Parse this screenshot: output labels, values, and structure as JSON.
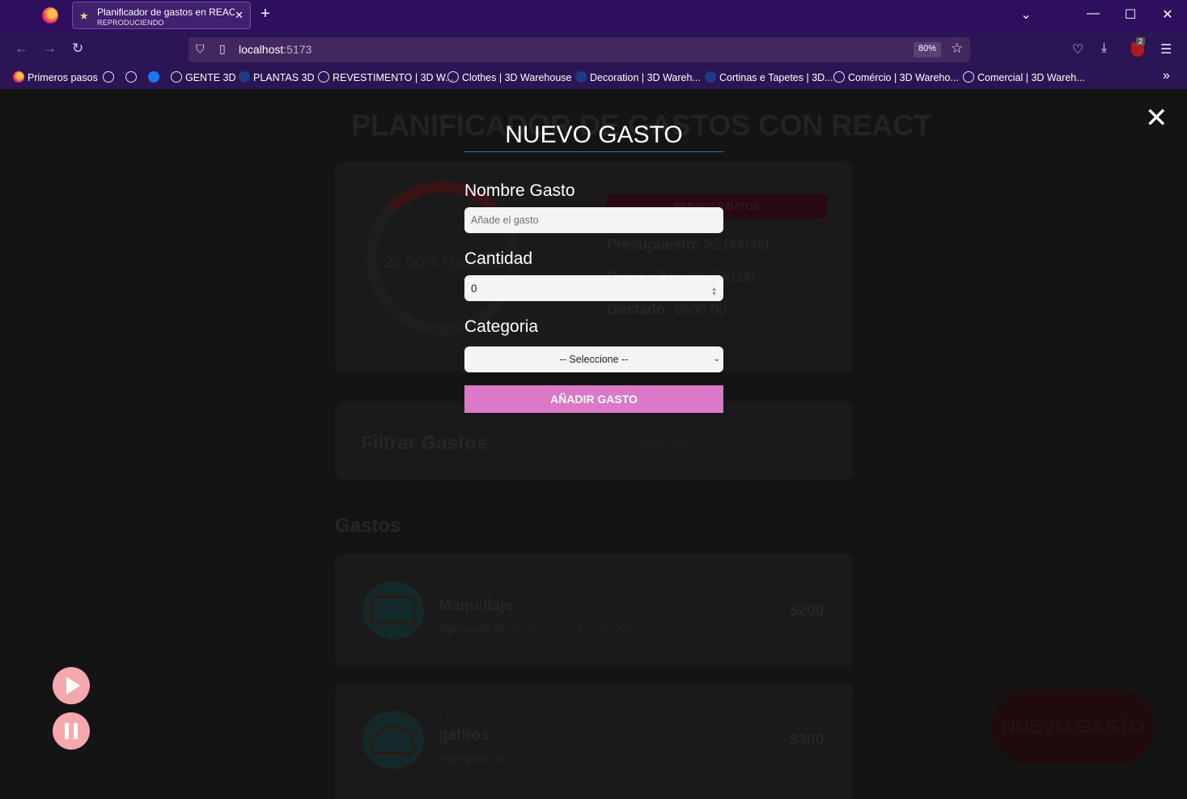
{
  "browser": {
    "tab_title": "Planificador de gastos en REACT",
    "tab_status": "REPRODUCIENDO",
    "url_host": "localhost",
    "url_port": ":5173",
    "zoom": "80%",
    "extension_badge": "2",
    "bookmarks": [
      {
        "label": "Primeros pasos",
        "icon": "firefox-icon"
      },
      {
        "label": "",
        "icon": "globe-icon"
      },
      {
        "label": "",
        "icon": "globe-icon"
      },
      {
        "label": "",
        "icon": "facebook-icon"
      },
      {
        "label": "GENTE 3D",
        "icon": "globe-icon"
      },
      {
        "label": "PLANTAS 3D",
        "icon": "sketchup-icon"
      },
      {
        "label": "REVESTIMENTO | 3D W...",
        "icon": "globe-icon"
      },
      {
        "label": "Clothes | 3D Warehouse",
        "icon": "globe-icon"
      },
      {
        "label": "Decoration | 3D Wareh...",
        "icon": "sketchup-icon"
      },
      {
        "label": "Cortinas e Tapetes | 3D...",
        "icon": "sketchup-icon"
      },
      {
        "label": "Comércio | 3D Wareho...",
        "icon": "globe-icon"
      },
      {
        "label": "Comercial | 3D Wareh...",
        "icon": "globe-icon"
      }
    ]
  },
  "background": {
    "title": "PLANIFICADOR DE GASTOS CON REACT",
    "percent_label": "25.00% Gastado",
    "reset_button": "REINICIAR DATOS",
    "presupuesto_label": "Presupuesto:",
    "presupuesto_value": "$2,000.00",
    "disponible_label": "Disponible:",
    "disponible_value": "$1,500.00",
    "gastado_label": "Gastado:",
    "gastado_value": "$500.00",
    "filter_label": "Filtrar Gastos",
    "filter_value": "-- Mostrar todo --",
    "list_title": "Gastos",
    "expenses": [
      {
        "category": "GASTOS",
        "name": "Maquillaje",
        "date_label": "Agregado el:",
        "date": "08 de noviembre de 2022",
        "amount": "$200"
      },
      {
        "category": "COMIDA",
        "name": "gatitos",
        "date_label": "Agregado el:",
        "date": "08 de noviembre de 2022",
        "amount": "$300"
      }
    ],
    "new_button": "NUEVO GASTO"
  },
  "modal": {
    "title": "NUEVO GASTO",
    "name_label": "Nombre Gasto",
    "name_placeholder": "Añade el gasto",
    "amount_label": "Cantidad",
    "amount_value": "0",
    "category_label": "Categoria",
    "category_value": "-- Seleccione --",
    "submit_label": "AÑADIR GASTO"
  },
  "colors": {
    "accent": "#db78c7",
    "player": "#f5a9ad",
    "titlebar": "#2d0f5e"
  }
}
